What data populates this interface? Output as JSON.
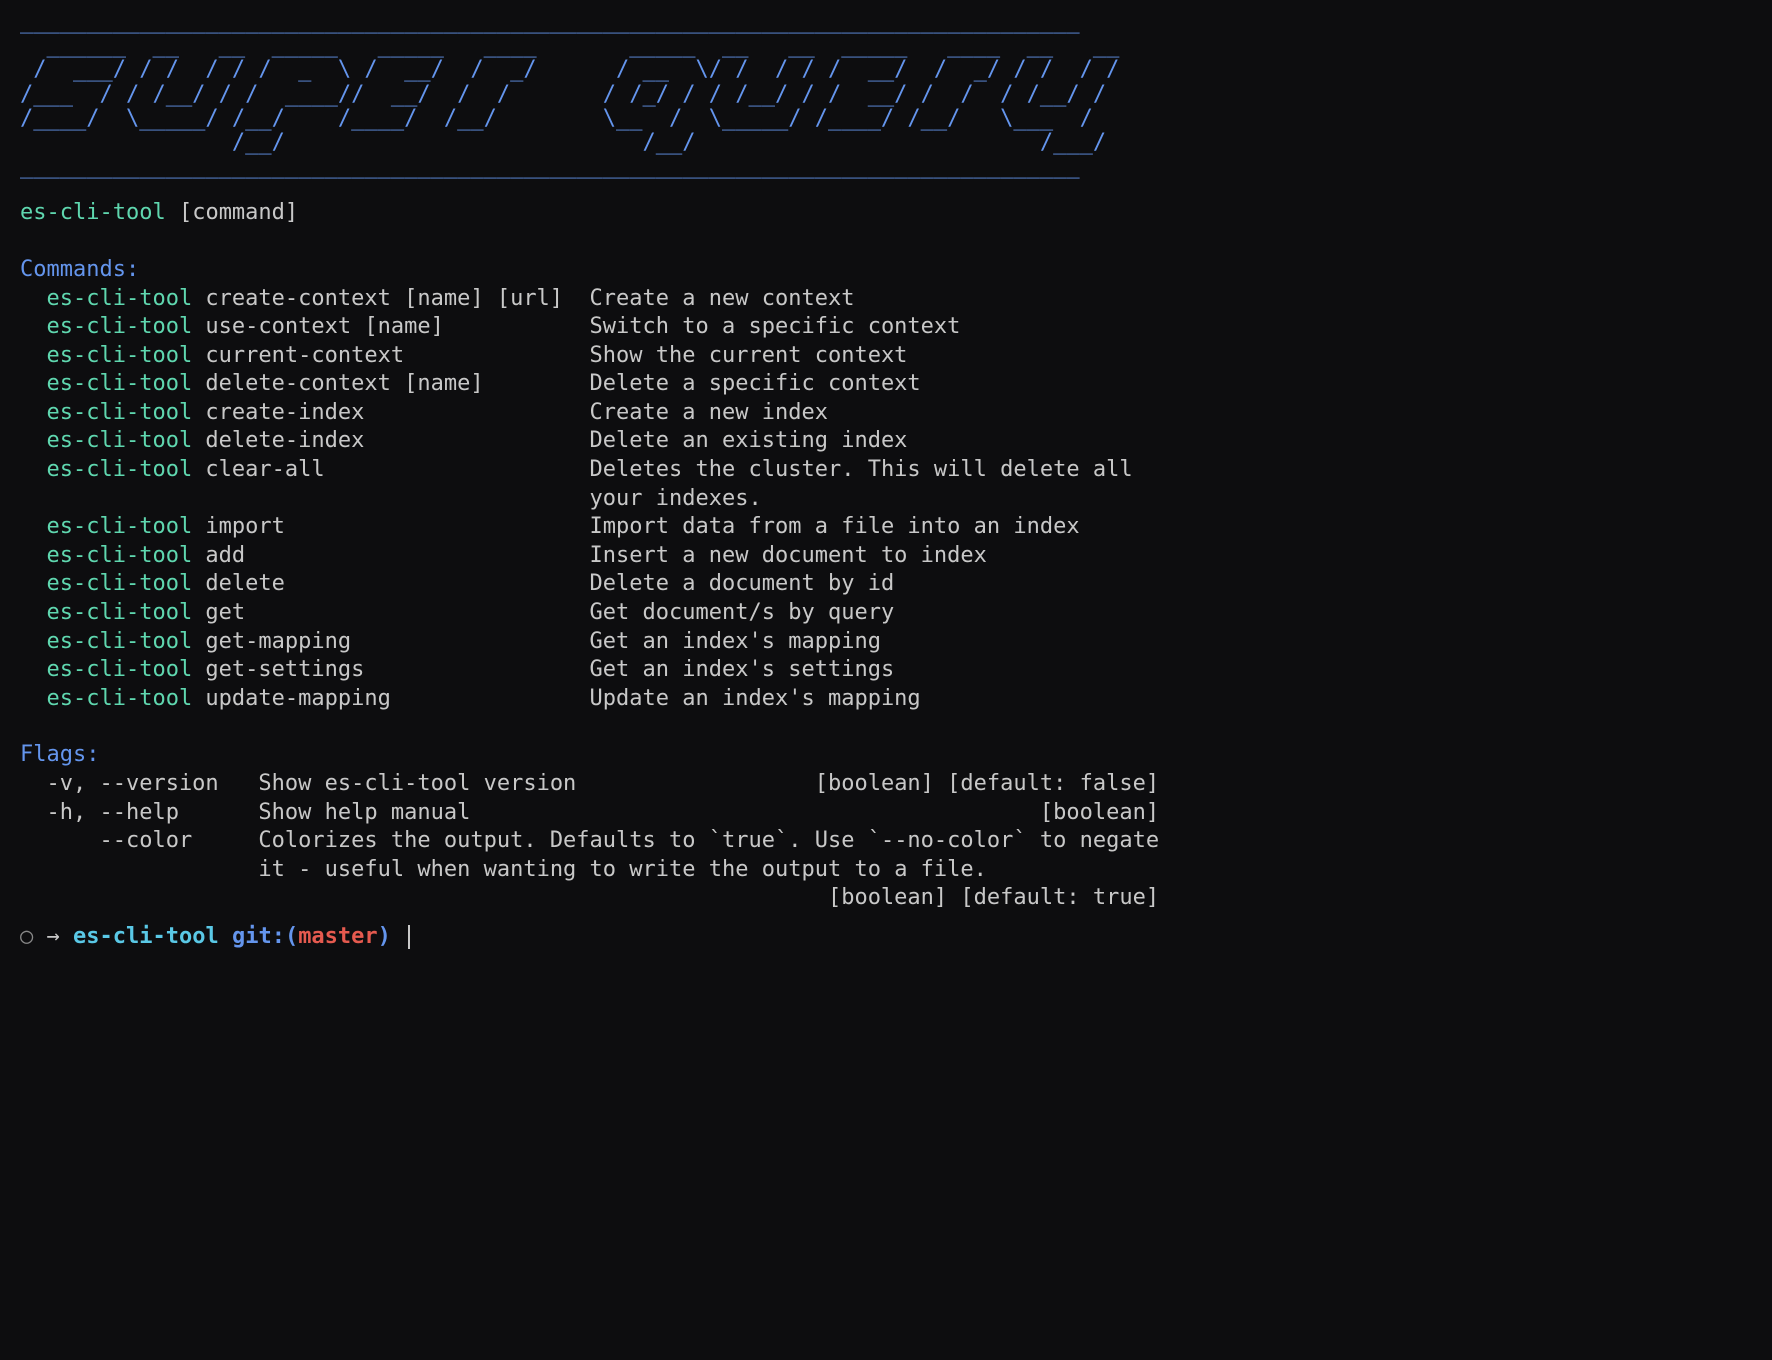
{
  "banner": "________________________________________________________________________________\n  ______  __   __  _____   _____   ____       _____  __   __  _____   ____  __   __\n /  ___/ / /  / / /  _  \\ /  __/  /  _/      / __  \\/ /  / / /  __/  /  _/ / /  / /\n/___  / / /__/ / /  ____//  __/  /  /       / /_/ / / /__/ / /  __/ /  /  / /__/ /\n/____/  \\_____/ /__/    /____/  /__/        \\__  /  \\_____/ /____/ /__/   \\___  /\n                /__/                           /__/                          /___/\n________________________________________________________________________________",
  "usage": {
    "tool": "es-cli-tool",
    "arg": "[command]"
  },
  "commandsLabel": "Commands:",
  "commands": [
    {
      "tool": "es-cli-tool",
      "cmd": "create-context [name] [url]",
      "desc": "Create a new context"
    },
    {
      "tool": "es-cli-tool",
      "cmd": "use-context [name]",
      "desc": "Switch to a specific context"
    },
    {
      "tool": "es-cli-tool",
      "cmd": "current-context",
      "desc": "Show the current context"
    },
    {
      "tool": "es-cli-tool",
      "cmd": "delete-context [name]",
      "desc": "Delete a specific context"
    },
    {
      "tool": "es-cli-tool",
      "cmd": "create-index",
      "desc": "Create a new index"
    },
    {
      "tool": "es-cli-tool",
      "cmd": "delete-index",
      "desc": "Delete an existing index"
    },
    {
      "tool": "es-cli-tool",
      "cmd": "clear-all",
      "desc": "Deletes the cluster. This will delete all your indexes."
    },
    {
      "tool": "es-cli-tool",
      "cmd": "import",
      "desc": "Import data from a file into an index"
    },
    {
      "tool": "es-cli-tool",
      "cmd": "add",
      "desc": "Insert a new document to index"
    },
    {
      "tool": "es-cli-tool",
      "cmd": "delete",
      "desc": "Delete a document by id"
    },
    {
      "tool": "es-cli-tool",
      "cmd": "get",
      "desc": "Get document/s by query"
    },
    {
      "tool": "es-cli-tool",
      "cmd": "get-mapping",
      "desc": "Get an index's mapping"
    },
    {
      "tool": "es-cli-tool",
      "cmd": "get-settings",
      "desc": "Get an index's settings"
    },
    {
      "tool": "es-cli-tool",
      "cmd": "update-mapping",
      "desc": "Update an index's mapping"
    }
  ],
  "flagsLabel": "Flags:",
  "flags": [
    {
      "name": "-v, --version",
      "desc": "Show es-cli-tool version",
      "meta": "[boolean] [default: false]"
    },
    {
      "name": "-h, --help",
      "desc": "Show help manual",
      "meta": "[boolean]"
    },
    {
      "name": "    --color",
      "desc": "Colorizes the output. Defaults to `true`. Use `--no-color` to negate it - useful when wanting to write the output to a file.",
      "meta": "[boolean] [default: true]"
    }
  ],
  "prompt": {
    "circle": "○",
    "arrow": "→",
    "dir": "es-cli-tool",
    "gitPrefix": "git:",
    "branch": "master"
  },
  "layout": {
    "cmdCol": 43,
    "flagNameCol": 15,
    "totalWidth": 86,
    "flagDescStart": 18
  }
}
